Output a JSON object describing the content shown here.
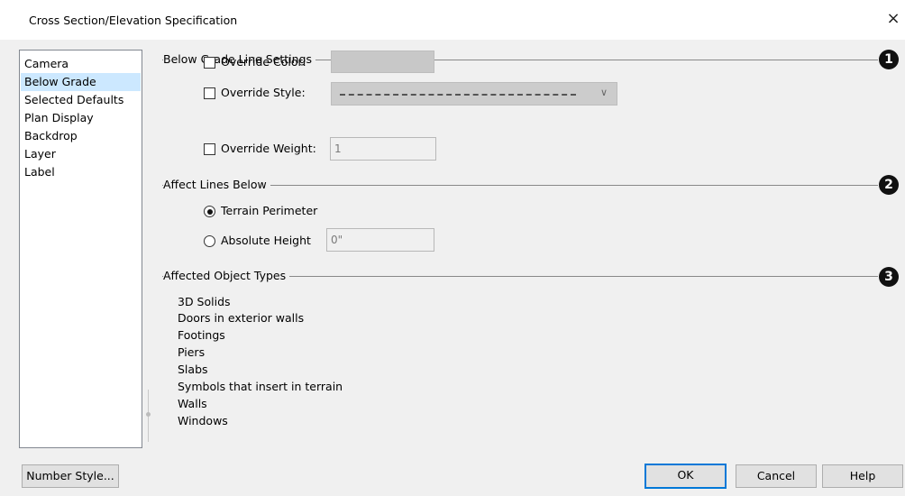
{
  "window": {
    "title": "Cross Section/Elevation Specification",
    "close_glyph": "×"
  },
  "sidebar": {
    "items": [
      {
        "label": "Camera",
        "selected": false
      },
      {
        "label": "Below Grade",
        "selected": true
      },
      {
        "label": "Selected Defaults",
        "selected": false
      },
      {
        "label": "Plan Display",
        "selected": false
      },
      {
        "label": "Backdrop",
        "selected": false
      },
      {
        "label": "Layer",
        "selected": false
      },
      {
        "label": "Label",
        "selected": false
      }
    ]
  },
  "below_grade_line_settings": {
    "heading": "Below Grade Line Settings",
    "badge": "1",
    "override_color": {
      "label": "Override Color:",
      "checked": false,
      "swatch_color": "#c8c8c8"
    },
    "override_style": {
      "label": "Override Style:",
      "checked": false,
      "icon": "chevron-down-icon"
    },
    "override_weight": {
      "label": "Override Weight:",
      "checked": false,
      "value": "1"
    }
  },
  "affect_lines_below": {
    "heading": "Affect Lines Below",
    "badge": "2",
    "terrain_perimeter": {
      "label": "Terrain Perimeter",
      "selected": true
    },
    "absolute_height": {
      "label": "Absolute Height",
      "selected": false,
      "value": "0\""
    }
  },
  "affected_object_types": {
    "heading": "Affected Object Types",
    "badge": "3",
    "items": [
      "3D Solids",
      "Doors in exterior walls",
      "Footings",
      "Piers",
      "Slabs",
      "Symbols that insert in terrain",
      "Walls",
      "Windows"
    ]
  },
  "buttons": {
    "number_style": "Number Style...",
    "ok": "OK",
    "cancel": "Cancel",
    "help": "Help"
  },
  "colors": {
    "selection": "#cce8ff",
    "default_button_border": "#0078d7",
    "badge": "#111111"
  }
}
